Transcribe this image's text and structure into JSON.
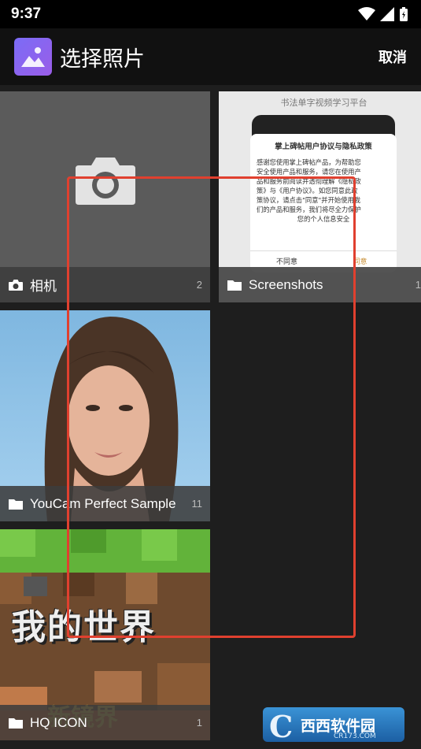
{
  "status": {
    "time": "9:37"
  },
  "app": {
    "title": "选择照片",
    "cancel_label": "取消"
  },
  "albums": [
    {
      "name": "相机",
      "count": "2",
      "icon": "camera-icon"
    },
    {
      "name": "Screenshots",
      "count": "1",
      "icon": "folder-icon"
    },
    {
      "name": "YouCam Perfect Sample",
      "count": "11",
      "icon": "folder-icon"
    },
    {
      "name": "HQ ICON",
      "count": "1",
      "icon": "folder-icon"
    }
  ],
  "screenshot_preview": {
    "header": "书法单字视频学习平台",
    "dialog_title": "掌上碑帖用户协议与隐私政策",
    "dialog_body_1": "感谢您使用掌上碑帖产品，为帮助您",
    "dialog_body_2": "安全使用产品和服务，请您在使用产",
    "dialog_body_3": "品和服务前阅读并透彻理解《隐私政",
    "dialog_body_4": "策》与《用户协议》。如您同意此政",
    "dialog_body_5": "策协议，请点击\"同意\"并开始使用我",
    "dialog_body_6": "们的产品和服务，我们将尽全力保护",
    "dialog_body_7": "您的个人信息安全",
    "disagree": "不同意",
    "agree": "同意"
  },
  "hq_preview": {
    "title": "我的世界",
    "subtitle": "新镜界"
  },
  "watermark": {
    "brand": "西西软件园",
    "site": "CR173.COM"
  },
  "colors": {
    "selection": "#e0402f",
    "app_icon": "#8a63ee"
  }
}
